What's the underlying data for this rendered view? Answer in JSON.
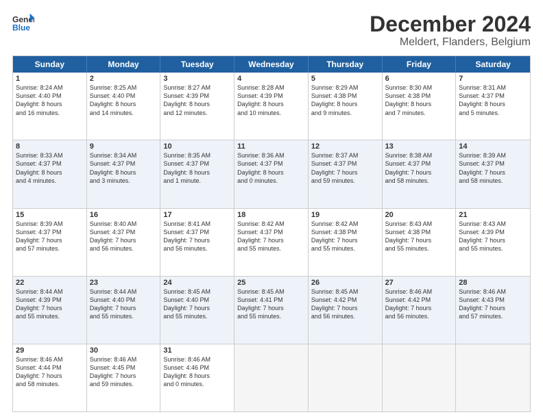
{
  "header": {
    "logo_line1": "General",
    "logo_line2": "Blue",
    "title": "December 2024",
    "subtitle": "Meldert, Flanders, Belgium"
  },
  "calendar": {
    "weekdays": [
      "Sunday",
      "Monday",
      "Tuesday",
      "Wednesday",
      "Thursday",
      "Friday",
      "Saturday"
    ],
    "rows": [
      [
        {
          "day": "1",
          "info": "Sunrise: 8:24 AM\nSunset: 4:40 PM\nDaylight: 8 hours\nand 16 minutes."
        },
        {
          "day": "2",
          "info": "Sunrise: 8:25 AM\nSunset: 4:40 PM\nDaylight: 8 hours\nand 14 minutes."
        },
        {
          "day": "3",
          "info": "Sunrise: 8:27 AM\nSunset: 4:39 PM\nDaylight: 8 hours\nand 12 minutes."
        },
        {
          "day": "4",
          "info": "Sunrise: 8:28 AM\nSunset: 4:39 PM\nDaylight: 8 hours\nand 10 minutes."
        },
        {
          "day": "5",
          "info": "Sunrise: 8:29 AM\nSunset: 4:38 PM\nDaylight: 8 hours\nand 9 minutes."
        },
        {
          "day": "6",
          "info": "Sunrise: 8:30 AM\nSunset: 4:38 PM\nDaylight: 8 hours\nand 7 minutes."
        },
        {
          "day": "7",
          "info": "Sunrise: 8:31 AM\nSunset: 4:37 PM\nDaylight: 8 hours\nand 5 minutes."
        }
      ],
      [
        {
          "day": "8",
          "info": "Sunrise: 8:33 AM\nSunset: 4:37 PM\nDaylight: 8 hours\nand 4 minutes."
        },
        {
          "day": "9",
          "info": "Sunrise: 8:34 AM\nSunset: 4:37 PM\nDaylight: 8 hours\nand 3 minutes."
        },
        {
          "day": "10",
          "info": "Sunrise: 8:35 AM\nSunset: 4:37 PM\nDaylight: 8 hours\nand 1 minute."
        },
        {
          "day": "11",
          "info": "Sunrise: 8:36 AM\nSunset: 4:37 PM\nDaylight: 8 hours\nand 0 minutes."
        },
        {
          "day": "12",
          "info": "Sunrise: 8:37 AM\nSunset: 4:37 PM\nDaylight: 7 hours\nand 59 minutes."
        },
        {
          "day": "13",
          "info": "Sunrise: 8:38 AM\nSunset: 4:37 PM\nDaylight: 7 hours\nand 58 minutes."
        },
        {
          "day": "14",
          "info": "Sunrise: 8:39 AM\nSunset: 4:37 PM\nDaylight: 7 hours\nand 58 minutes."
        }
      ],
      [
        {
          "day": "15",
          "info": "Sunrise: 8:39 AM\nSunset: 4:37 PM\nDaylight: 7 hours\nand 57 minutes."
        },
        {
          "day": "16",
          "info": "Sunrise: 8:40 AM\nSunset: 4:37 PM\nDaylight: 7 hours\nand 56 minutes."
        },
        {
          "day": "17",
          "info": "Sunrise: 8:41 AM\nSunset: 4:37 PM\nDaylight: 7 hours\nand 56 minutes."
        },
        {
          "day": "18",
          "info": "Sunrise: 8:42 AM\nSunset: 4:37 PM\nDaylight: 7 hours\nand 55 minutes."
        },
        {
          "day": "19",
          "info": "Sunrise: 8:42 AM\nSunset: 4:38 PM\nDaylight: 7 hours\nand 55 minutes."
        },
        {
          "day": "20",
          "info": "Sunrise: 8:43 AM\nSunset: 4:38 PM\nDaylight: 7 hours\nand 55 minutes."
        },
        {
          "day": "21",
          "info": "Sunrise: 8:43 AM\nSunset: 4:39 PM\nDaylight: 7 hours\nand 55 minutes."
        }
      ],
      [
        {
          "day": "22",
          "info": "Sunrise: 8:44 AM\nSunset: 4:39 PM\nDaylight: 7 hours\nand 55 minutes."
        },
        {
          "day": "23",
          "info": "Sunrise: 8:44 AM\nSunset: 4:40 PM\nDaylight: 7 hours\nand 55 minutes."
        },
        {
          "day": "24",
          "info": "Sunrise: 8:45 AM\nSunset: 4:40 PM\nDaylight: 7 hours\nand 55 minutes."
        },
        {
          "day": "25",
          "info": "Sunrise: 8:45 AM\nSunset: 4:41 PM\nDaylight: 7 hours\nand 55 minutes."
        },
        {
          "day": "26",
          "info": "Sunrise: 8:45 AM\nSunset: 4:42 PM\nDaylight: 7 hours\nand 56 minutes."
        },
        {
          "day": "27",
          "info": "Sunrise: 8:46 AM\nSunset: 4:42 PM\nDaylight: 7 hours\nand 56 minutes."
        },
        {
          "day": "28",
          "info": "Sunrise: 8:46 AM\nSunset: 4:43 PM\nDaylight: 7 hours\nand 57 minutes."
        }
      ],
      [
        {
          "day": "29",
          "info": "Sunrise: 8:46 AM\nSunset: 4:44 PM\nDaylight: 7 hours\nand 58 minutes."
        },
        {
          "day": "30",
          "info": "Sunrise: 8:46 AM\nSunset: 4:45 PM\nDaylight: 7 hours\nand 59 minutes."
        },
        {
          "day": "31",
          "info": "Sunrise: 8:46 AM\nSunset: 4:46 PM\nDaylight: 8 hours\nand 0 minutes."
        },
        {
          "day": "",
          "info": ""
        },
        {
          "day": "",
          "info": ""
        },
        {
          "day": "",
          "info": ""
        },
        {
          "day": "",
          "info": ""
        }
      ]
    ]
  }
}
